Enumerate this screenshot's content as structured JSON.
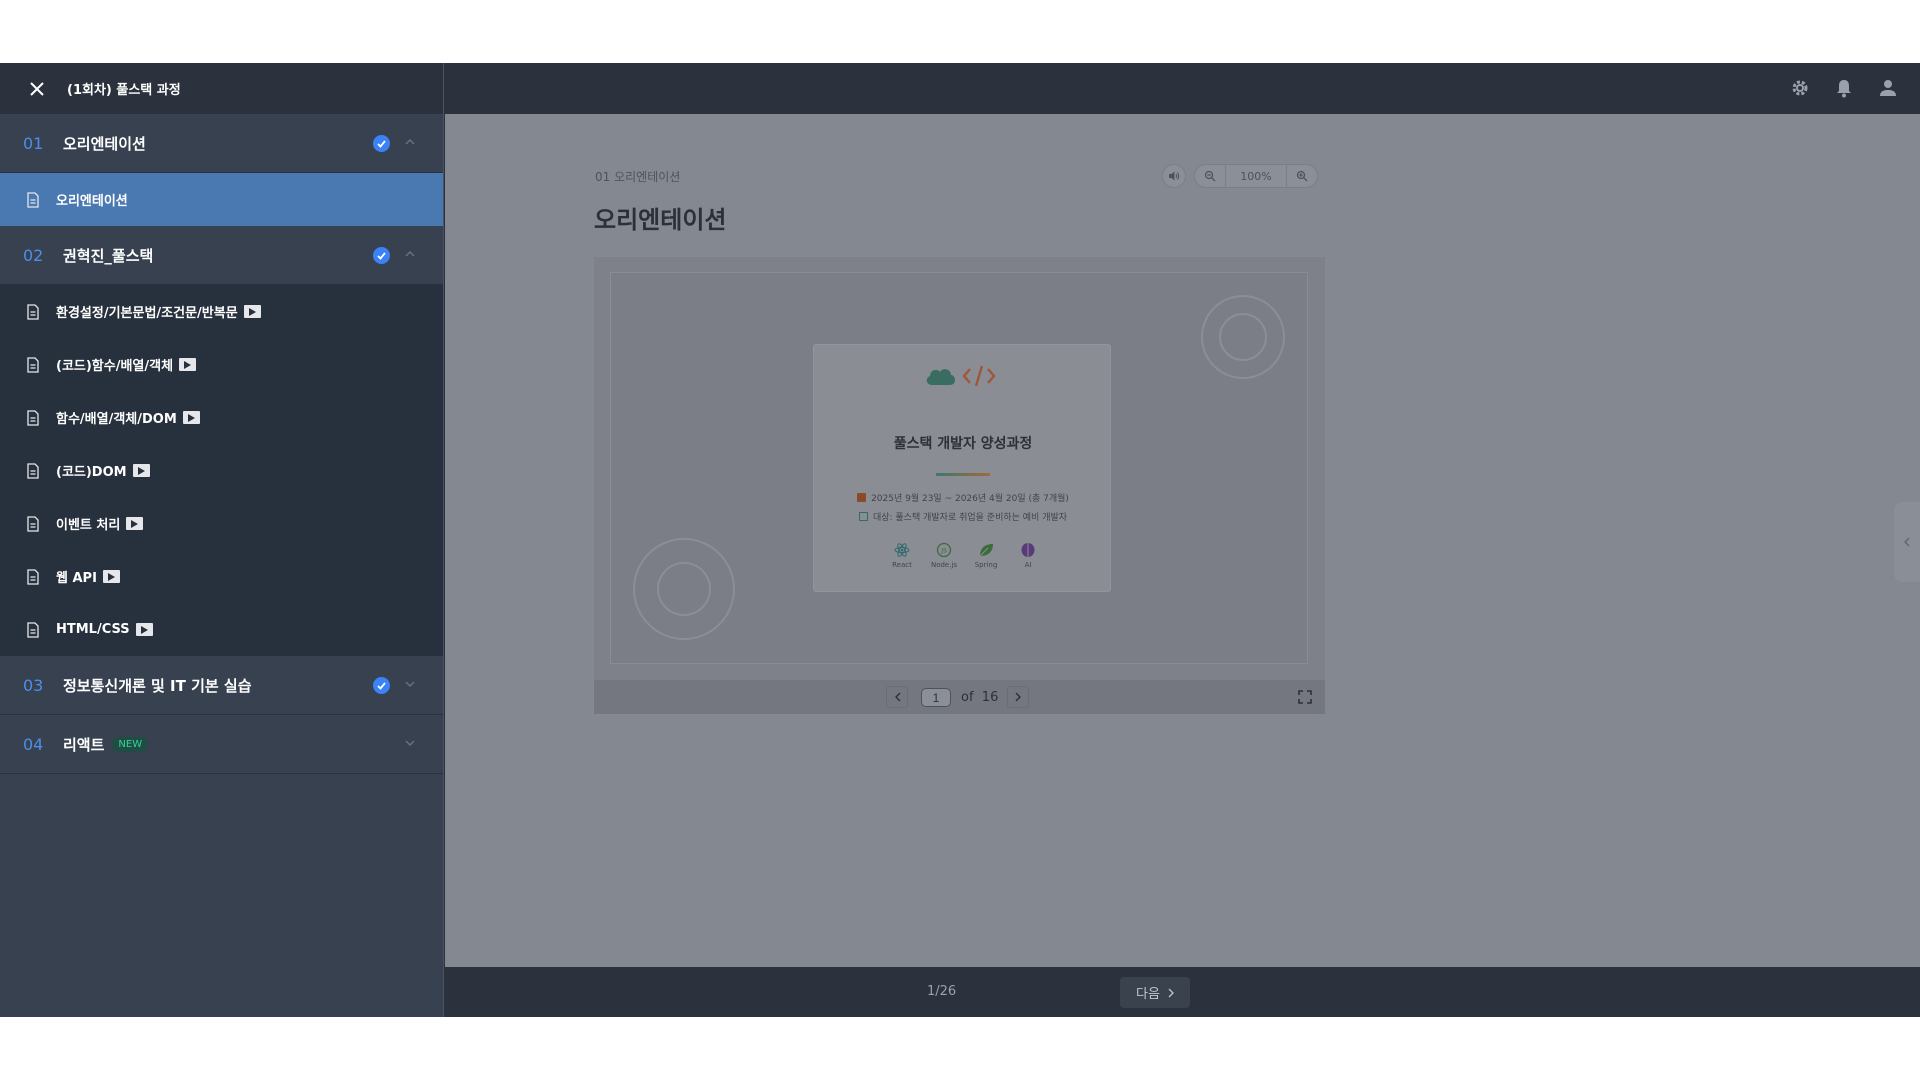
{
  "course_title": "(1회차) 풀스택 과정",
  "sections": [
    {
      "num": "01",
      "name": "오리엔테이션"
    },
    {
      "num": "02",
      "name": "권혁진_풀스택"
    },
    {
      "num": "03",
      "name": "정보통신개론 및 IT 기본 실습"
    },
    {
      "num": "04",
      "name": "리액트",
      "badge": "NEW"
    }
  ],
  "lessons_s1": [
    {
      "label": "오리엔테이션"
    }
  ],
  "lessons_s2": [
    {
      "label": "환경설정/기본문법/조건문/반복문"
    },
    {
      "label": "(코드)함수/배열/객체"
    },
    {
      "label": "함수/배열/객체/DOM"
    },
    {
      "label": "(코드)DOM"
    },
    {
      "label": "이벤트 처리"
    },
    {
      "label": "웹 API"
    },
    {
      "label": "HTML/CSS"
    }
  ],
  "content": {
    "breadcrumb": "01 오리엔테이션",
    "title": "오리엔테이션",
    "zoom": "100%"
  },
  "slide": {
    "title": "풀스택 개발자 양성과정",
    "period": "2025년 9월 23일 ~ 2026년 4월 20일 (총 7개월)",
    "target": "대상: 풀스택 개발자로 취업을 준비하는 예비 개발자",
    "techs": [
      "React",
      "Node.js",
      "Spring",
      "AI"
    ]
  },
  "viewer": {
    "page": "1",
    "of": "of",
    "total": "16"
  },
  "footer": {
    "progress": "1/26",
    "next_label": "다음"
  },
  "colors": {
    "accent": "#3b82f6",
    "active_lesson": "#4a78b0",
    "new_badge": "#34d399"
  }
}
